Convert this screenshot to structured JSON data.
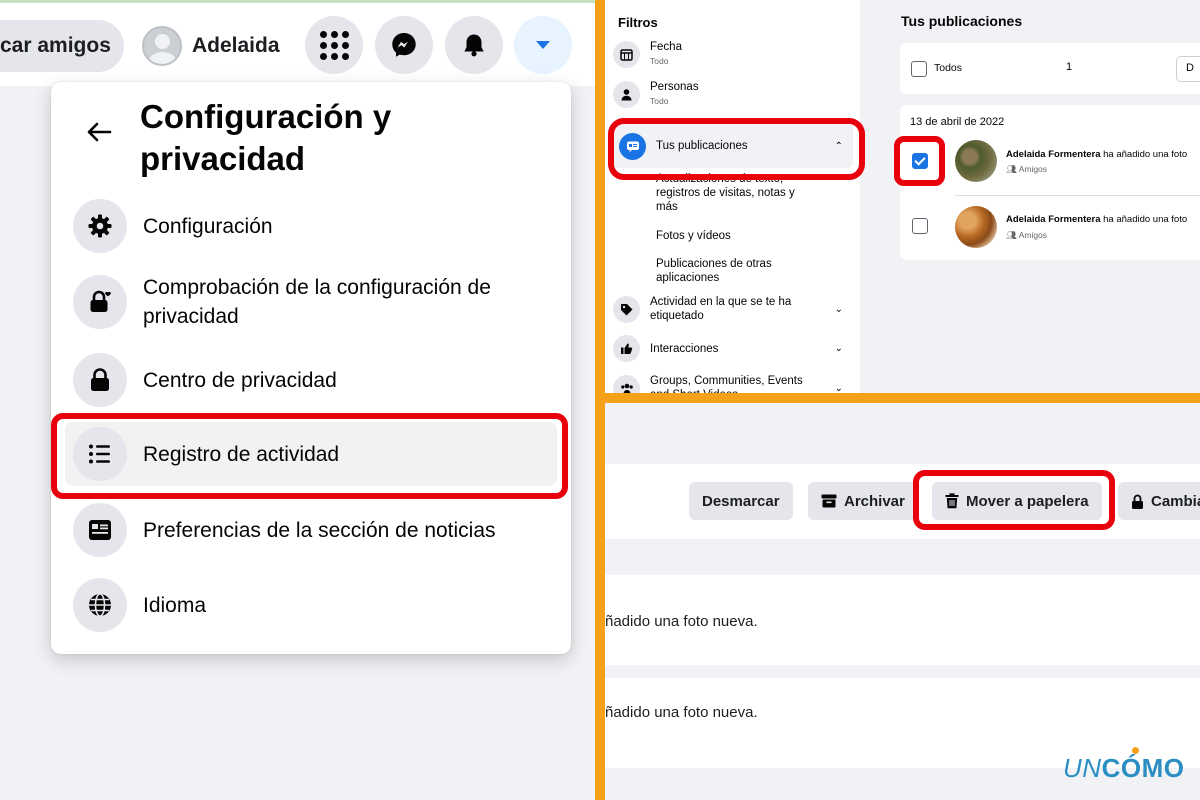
{
  "left_panel": {
    "topbar": {
      "find_friends": "car amigos",
      "profile_name": "Adelaida"
    },
    "menu": {
      "title": "Configuración y privacidad",
      "items": [
        {
          "label": "Configuración",
          "icon": "gear-icon"
        },
        {
          "label": "Comprobación de la configuración de privacidad",
          "icon": "lock-heart-icon"
        },
        {
          "label": "Centro de privacidad",
          "icon": "lock-icon"
        },
        {
          "label": "Registro de actividad",
          "icon": "list-icon",
          "highlighted": true
        },
        {
          "label": "Preferencias de la sección de noticias",
          "icon": "news-feed-icon"
        },
        {
          "label": "Idioma",
          "icon": "globe-icon"
        }
      ]
    }
  },
  "top_right": {
    "filters": {
      "title": "Filtros",
      "items": [
        {
          "label": "Fecha",
          "sub": "Todo"
        },
        {
          "label": "Personas",
          "sub": "Todo"
        },
        {
          "label": "Tus publicaciones",
          "selected": true
        },
        {
          "label": "Actualizaciones de texto, registros de visitas, notas y más"
        },
        {
          "label": "Fotos y vídeos"
        },
        {
          "label": "Publicaciones de otras aplicaciones"
        },
        {
          "label": "Actividad en la que se te ha etiquetado"
        },
        {
          "label": "Interacciones"
        },
        {
          "label": "Groups, Communities, Events and Short Videos"
        }
      ]
    },
    "posts": {
      "title": "Tus publicaciones",
      "select_all_label": "Todos",
      "select_count": "1",
      "date": "13 de abril de 2022",
      "rows": [
        {
          "author": "Adelaida Formentera",
          "action": " ha añadido una foto",
          "audience": "Amigos",
          "checked": true
        },
        {
          "author": "Adelaida Formentera",
          "action": " ha añadido una foto",
          "audience": "Amigos",
          "checked": false
        }
      ]
    }
  },
  "bottom_right": {
    "buttons": {
      "unmark": "Desmarcar",
      "archive": "Archivar",
      "trash": "Mover a papelera",
      "change": "Cambia"
    },
    "rows": [
      {
        "text": "ñadido una foto nueva."
      },
      {
        "text": "ñadido una foto nueva."
      }
    ],
    "logo": {
      "un": "UN",
      "como": "CÓMO"
    }
  },
  "colors": {
    "highlight_red": "#e8000c",
    "divider_orange": "#f7a11a",
    "facebook_blue": "#1b74e4",
    "logo_blue": "#2a8ec2"
  }
}
